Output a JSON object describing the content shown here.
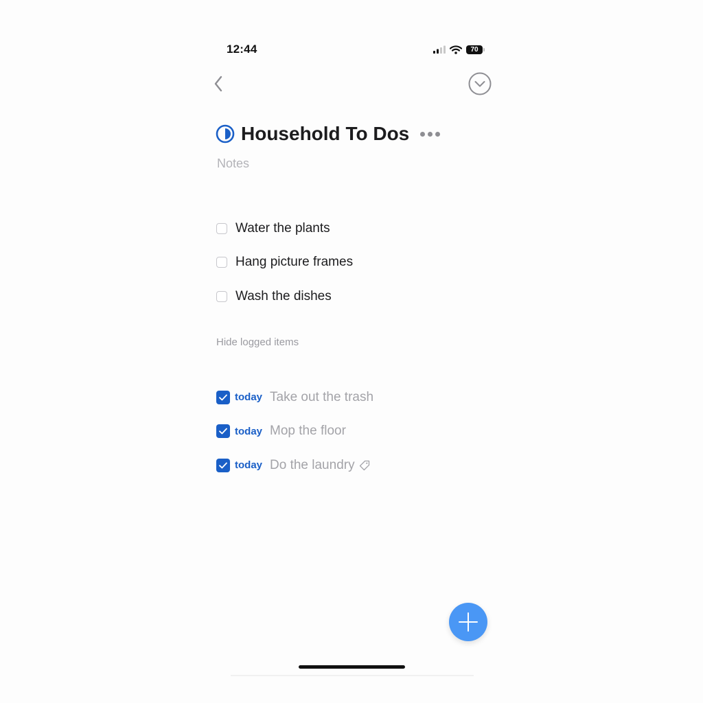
{
  "status_bar": {
    "time": "12:44",
    "battery": "70"
  },
  "header": {
    "title": "Household To Dos",
    "notes_placeholder": "Notes"
  },
  "todos": [
    {
      "label": "Water the plants"
    },
    {
      "label": "Hang picture frames"
    },
    {
      "label": "Wash the dishes"
    }
  ],
  "logged_toggle_label": "Hide logged items",
  "logged": [
    {
      "when": "today",
      "label": "Take out the trash",
      "has_tag": false
    },
    {
      "when": "today",
      "label": "Mop the floor",
      "has_tag": false
    },
    {
      "when": "today",
      "label": "Do the laundry",
      "has_tag": true
    }
  ],
  "colors": {
    "accent": "#1a5fc7",
    "fab": "#4a97f5",
    "muted_text": "#a3a3a8"
  },
  "icons": {
    "back": "chevron-left-icon",
    "collapse": "chevron-down-circle-icon",
    "project": "half-filled-circle-icon",
    "more": "ellipsis-icon",
    "check": "checkmark-icon",
    "tag": "tag-icon",
    "add": "plus-icon"
  }
}
